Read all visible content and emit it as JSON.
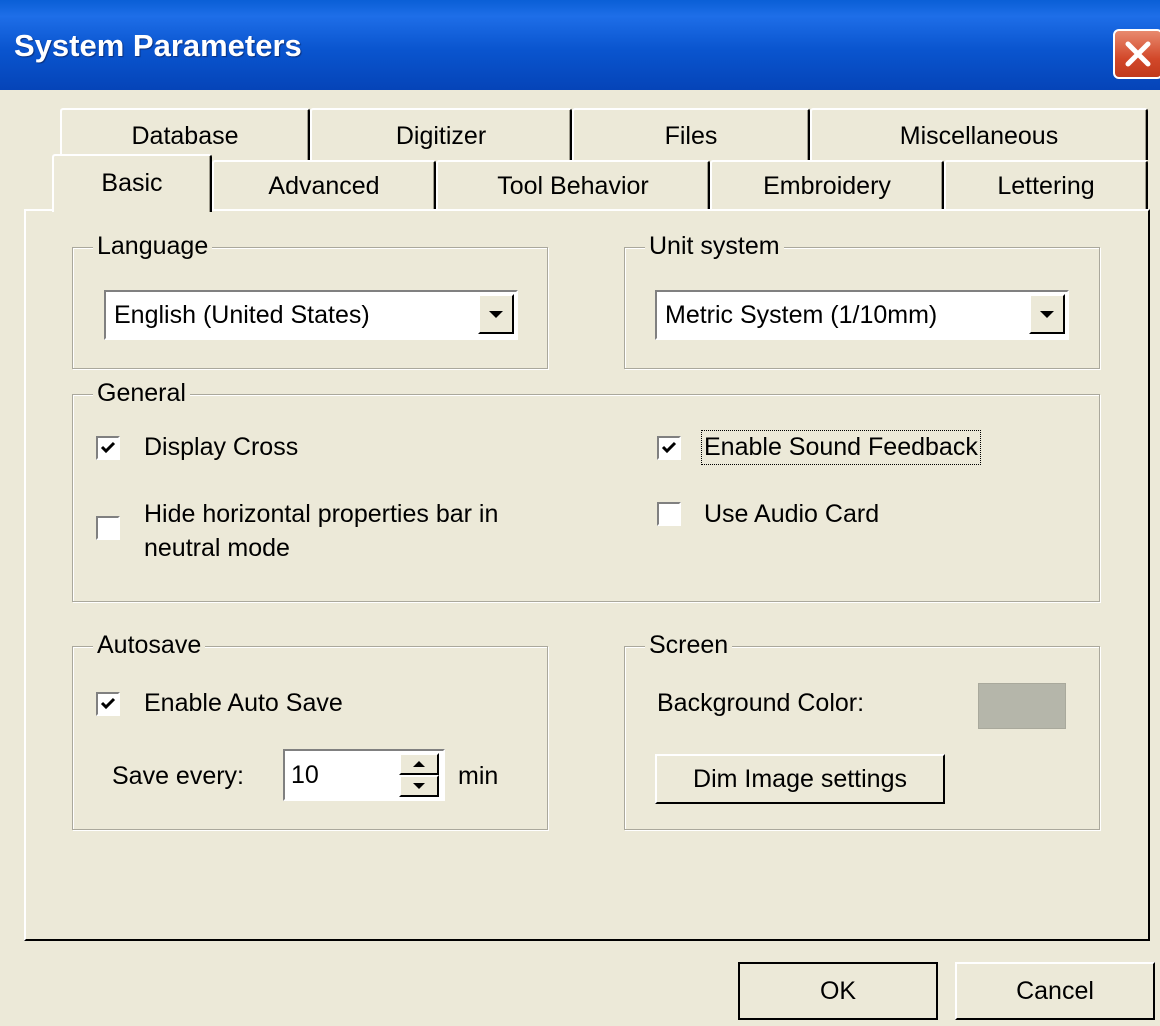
{
  "window": {
    "title": "System Parameters"
  },
  "tabs_row_top": [
    {
      "label": "Database"
    },
    {
      "label": "Digitizer"
    },
    {
      "label": "Files"
    },
    {
      "label": "Miscellaneous"
    }
  ],
  "tabs_row_bottom": [
    {
      "label": "Basic",
      "active": true
    },
    {
      "label": "Advanced"
    },
    {
      "label": "Tool Behavior"
    },
    {
      "label": "Embroidery"
    },
    {
      "label": "Lettering"
    }
  ],
  "language": {
    "legend": "Language",
    "value": "English (United States)"
  },
  "unit_system": {
    "legend": "Unit system",
    "value": "Metric System (1/10mm)"
  },
  "general": {
    "legend": "General",
    "display_cross": {
      "label": "Display Cross",
      "checked": true
    },
    "hide_bar": {
      "label_line1": "Hide horizontal properties bar in",
      "label_line2": "neutral mode",
      "checked": false
    },
    "sound_feedback": {
      "label": "Enable Sound Feedback",
      "checked": true
    },
    "audio_card": {
      "label": "Use Audio Card",
      "checked": false
    }
  },
  "autosave": {
    "legend": "Autosave",
    "enable": {
      "label": "Enable Auto Save",
      "checked": true
    },
    "save_every_label": "Save every:",
    "interval": "10",
    "unit": "min"
  },
  "screen": {
    "legend": "Screen",
    "bg_label": "Background Color:",
    "bg_color": "#b5b6aa",
    "dim_button": "Dim Image settings"
  },
  "footer": {
    "ok": "OK",
    "cancel": "Cancel"
  },
  "colors": {
    "titlebar": "#0a55cf",
    "dialog_bg": "#ece9d8",
    "close_button": "#d2482a"
  },
  "icons": [
    "close-icon",
    "check-icon",
    "dropdown-arrow-icon",
    "spin-up-icon",
    "spin-down-icon"
  ]
}
